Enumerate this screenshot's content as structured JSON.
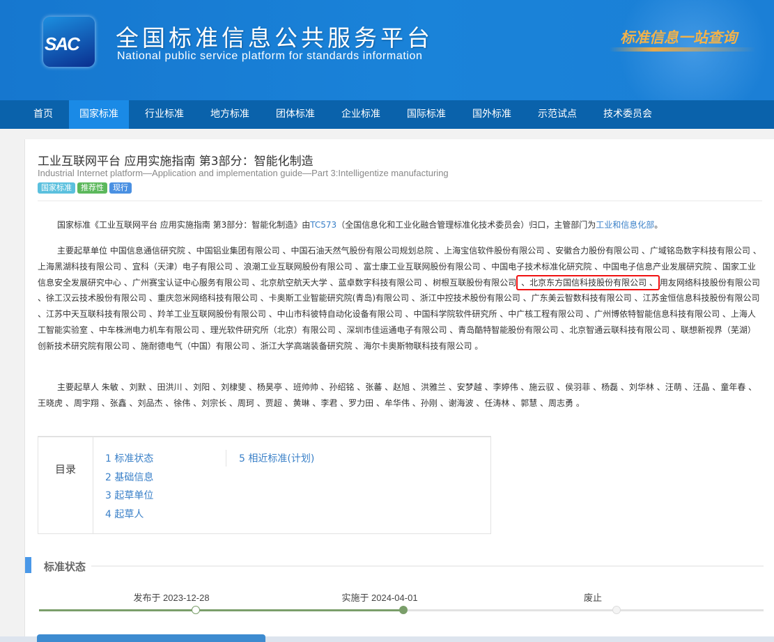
{
  "header": {
    "logo_text": "SAC",
    "title_cn": "全国标准信息公共服务平台",
    "title_en": "National public service platform  for standards information",
    "slogan": "标准信息一站查询"
  },
  "nav": {
    "items": [
      {
        "label": "首页"
      },
      {
        "label": "国家标准",
        "active": true
      },
      {
        "label": "行业标准"
      },
      {
        "label": "地方标准"
      },
      {
        "label": "团体标准"
      },
      {
        "label": "企业标准"
      },
      {
        "label": "国际标准"
      },
      {
        "label": "国外标准"
      },
      {
        "label": "示范试点"
      },
      {
        "label": "技术委员会"
      }
    ]
  },
  "standard": {
    "title": "工业互联网平台 应用实施指南 第3部分：智能化制造",
    "title_en": "Industrial Internet platform—Application and implementation guide—Part 3:Intelligentize manufacturing",
    "badges": [
      {
        "label": "国家标准",
        "color": "#5bc0de"
      },
      {
        "label": "推荐性",
        "color": "#5cb85c"
      },
      {
        "label": "现行",
        "color": "#4a90e2"
      }
    ],
    "intro": {
      "prefix": "国家标准《工业互联网平台 应用实施指南 第3部分：智能化制造》由",
      "tc": "TC573",
      "middle": "（全国信息化和工业化融合管理标准化技术委员会）归口，主管部门为",
      "dept": "工业和信息化部",
      "suffix": "。"
    },
    "units_label": "主要起草单位",
    "units_before": "中国信息通信研究院 、中国铝业集团有限公司 、中国石油天然气股份有限公司规划总院 、上海宝信软件股份有限公司 、安徽合力股份有限公司 、广域铭岛数字科技有限公司 、上海黑湖科技有限公司 、宜科（天津）电子有限公司 、浪潮工业互联网股份有限公司 、富士康工业互联网股份有限公司 、中国电子技术标准化研究院 、中国电子信息产业发展研究院 、国家工业信息安全发展研究中心 、广州赛宝认证中心服务有限公司 、北京航空航天大学 、蓝卓数字科技有限公司 、树根互联股份有限公司",
    "units_highlight": " 、北京东方国信科技股份有限公司 、",
    "units_after": "用友网络科技股份有限公司 、徐工汉云技术股份有限公司 、重庆忽米网络科技有限公司 、卡奥斯工业智能研究院(青岛)有限公司 、浙江中控技术股份有限公司 、广东美云智数科技有限公司 、江苏金恒信息科技股份有限公司 、江苏中天互联科技有限公司 、羚羊工业互联网股份有限公司 、中山市科彼特自动化设备有限公司 、中国科学院软件研究所 、中广核工程有限公司 、广州博依特智能信息科技有限公司 、上海人工智能实验室 、中车株洲电力机车有限公司 、理光软件研究所（北京）有限公司 、深圳市佳运通电子有限公司 、青岛酷特智能股份有限公司 、北京智通云联科技有限公司 、联想新视界（芜湖）创新技术研究院有限公司 、施耐德电气（中国）有限公司 、浙江大学高端装备研究院 、海尔卡奥斯物联科技有限公司 。",
    "drafters_label": "主要起草人",
    "drafters": "朱敏 、刘默 、田洪川 、刘阳 、刘棣斐 、杨昊亭 、班帅帅 、孙绍铭 、张蕃 、赵旭 、洪雅兰 、安梦越 、李婷伟 、施云驭 、侯羽菲 、杨磊 、刘华林 、汪萌 、汪晶 、童年春 、王晓虎 、周宇翔 、张鑫 、刘品杰 、徐伟 、刘宗长 、周珂 、贾超 、黄琳 、李君 、罗力田 、牟华伟 、孙刚 、谢海波 、任涛林 、郭慧 、周志勇 。"
  },
  "toc": {
    "label": "目录",
    "items": [
      "1  标准状态",
      "2  基础信息",
      "3  起草单位",
      "4  起草人",
      "5  相近标准(计划)"
    ]
  },
  "status": {
    "title": "标准状态",
    "timeline": [
      {
        "label": "发布于 2023-12-28",
        "done": true
      },
      {
        "label": "实施于 2024-04-01",
        "done": true,
        "current": true
      },
      {
        "label": "废止",
        "done": false
      }
    ],
    "progress_color": "#7a9e6a"
  }
}
